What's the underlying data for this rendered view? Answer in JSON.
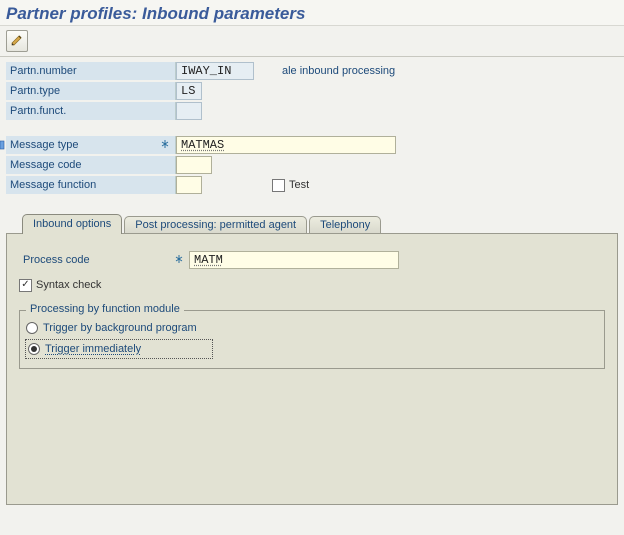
{
  "title": "Partner profiles: Inbound parameters",
  "toolbar": {
    "edit_tooltip": "Display/Change"
  },
  "form": {
    "partn_number": {
      "label": "Partn.number",
      "value": "IWAY_IN",
      "aux": "ale inbound processing"
    },
    "partn_type": {
      "label": "Partn.type",
      "value": "LS"
    },
    "partn_funct": {
      "label": "Partn.funct.",
      "value": ""
    },
    "message_type": {
      "label": "Message type",
      "value": "MATMAS"
    },
    "message_code": {
      "label": "Message code",
      "value": ""
    },
    "message_func": {
      "label": "Message function",
      "value": ""
    },
    "test": {
      "label": "Test",
      "checked": false
    }
  },
  "tabs": {
    "inbound": {
      "label": "Inbound options"
    },
    "post": {
      "label": "Post processing: permitted agent"
    },
    "telephony": {
      "label": "Telephony"
    },
    "active": "inbound"
  },
  "inbound": {
    "process_code": {
      "label": "Process code",
      "value": "MATM"
    },
    "syntax_check": {
      "label": "Syntax check",
      "checked": true
    },
    "processing_group_title": "Processing by function module",
    "radio_background": {
      "label": "Trigger by background program"
    },
    "radio_immediate": {
      "label": "Trigger immediately"
    },
    "selected": "immediate"
  }
}
